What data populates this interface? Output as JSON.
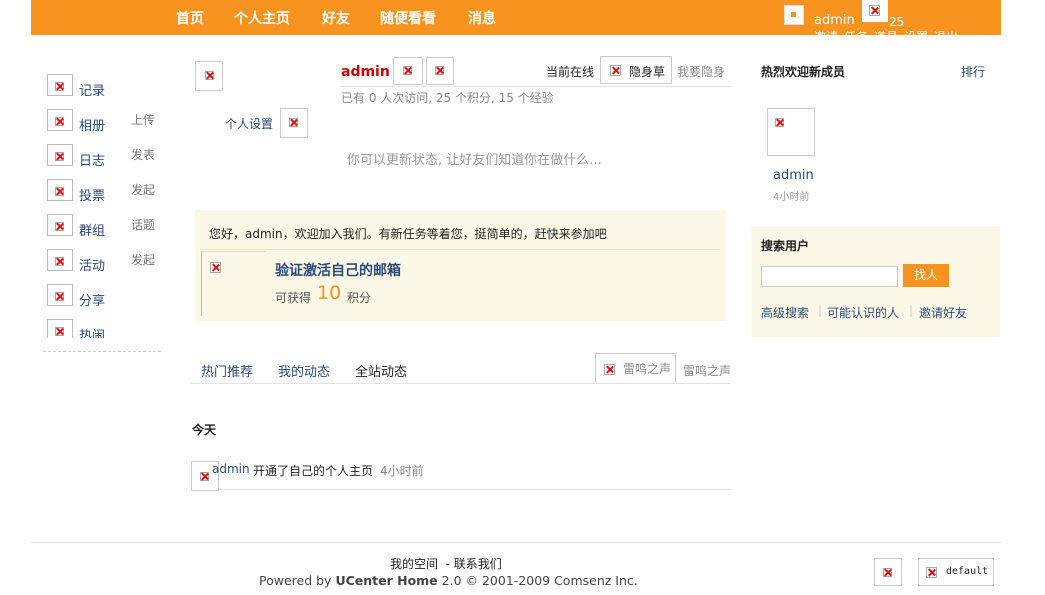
{
  "header": {
    "nav": [
      "首页",
      "个人主页",
      "好友",
      "随便看看",
      "消息"
    ],
    "user": "admin",
    "count": "25",
    "links": [
      "邀请",
      "任务",
      "道具",
      "设置",
      "退出"
    ]
  },
  "sidebar": {
    "items": [
      {
        "label": "记录",
        "action": ""
      },
      {
        "label": "相册",
        "action": "上传"
      },
      {
        "label": "日志",
        "action": "发表"
      },
      {
        "label": "投票",
        "action": "发起"
      },
      {
        "label": "群组",
        "action": "话题"
      },
      {
        "label": "活动",
        "action": "发起"
      },
      {
        "label": "分享",
        "action": ""
      },
      {
        "label": "热闹",
        "action": ""
      }
    ]
  },
  "profile": {
    "name": "admin",
    "stats": "已有  0 人次访问, 25 个积分, 15 个经验",
    "online_status": "当前在线",
    "stealth_label": "隐身草",
    "stealth_action": "我要隐身",
    "settings": "个人设置",
    "status_placeholder": "你可以更新状态, 让好友们知道你在做什么..."
  },
  "welcome": {
    "text": "您好，admin，欢迎加入我们。有新任务等着您，挺简单的，赶快来参加吧",
    "task_title": "验证激活自己的邮箱",
    "reward_prefix": "可获得",
    "reward_value": "10",
    "reward_suffix": "积分"
  },
  "feed": {
    "tabs": [
      "热门推荐",
      "我的动态",
      "全站动态"
    ],
    "right_label": "雷鸣之声",
    "right_link": "雷鸣之声",
    "day": "今天",
    "items": [
      {
        "user": "admin",
        "text": "开通了自己的个人主页",
        "time": "4小时前"
      }
    ]
  },
  "right": {
    "new_members_title": "热烈欢迎新成员",
    "rank_link": "排行",
    "member_name": "admin",
    "member_time": "4小时前",
    "search_title": "搜索用户",
    "search_button": "找人",
    "links": [
      "高级搜索",
      "可能认识的人",
      "邀请好友"
    ]
  },
  "footer": {
    "links": "我的空间  - 联系我们",
    "powered_prefix": "Powered by ",
    "powered_brand": "UCenter Home",
    "powered_suffix": " 2.0 © 2001-2009 Comsenz Inc.",
    "theme": "default"
  }
}
